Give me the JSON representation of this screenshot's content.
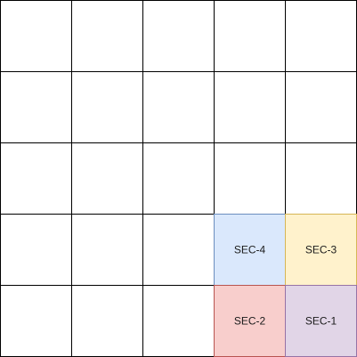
{
  "grid": {
    "rows": 5,
    "cols": 5,
    "line_color": "#000000",
    "default_fill": "#ffffff"
  },
  "sections": [
    {
      "label": "SEC-4",
      "row": 4,
      "col": 4,
      "fill": "#dae8fc",
      "stroke": "#6c8ebf"
    },
    {
      "label": "SEC-3",
      "row": 4,
      "col": 5,
      "fill": "#fff2cc",
      "stroke": "#d6b656"
    },
    {
      "label": "SEC-2",
      "row": 5,
      "col": 4,
      "fill": "#f8cecc",
      "stroke": "#b85450"
    },
    {
      "label": "SEC-1",
      "row": 5,
      "col": 5,
      "fill": "#e1d5e7",
      "stroke": "#9673a6"
    }
  ]
}
